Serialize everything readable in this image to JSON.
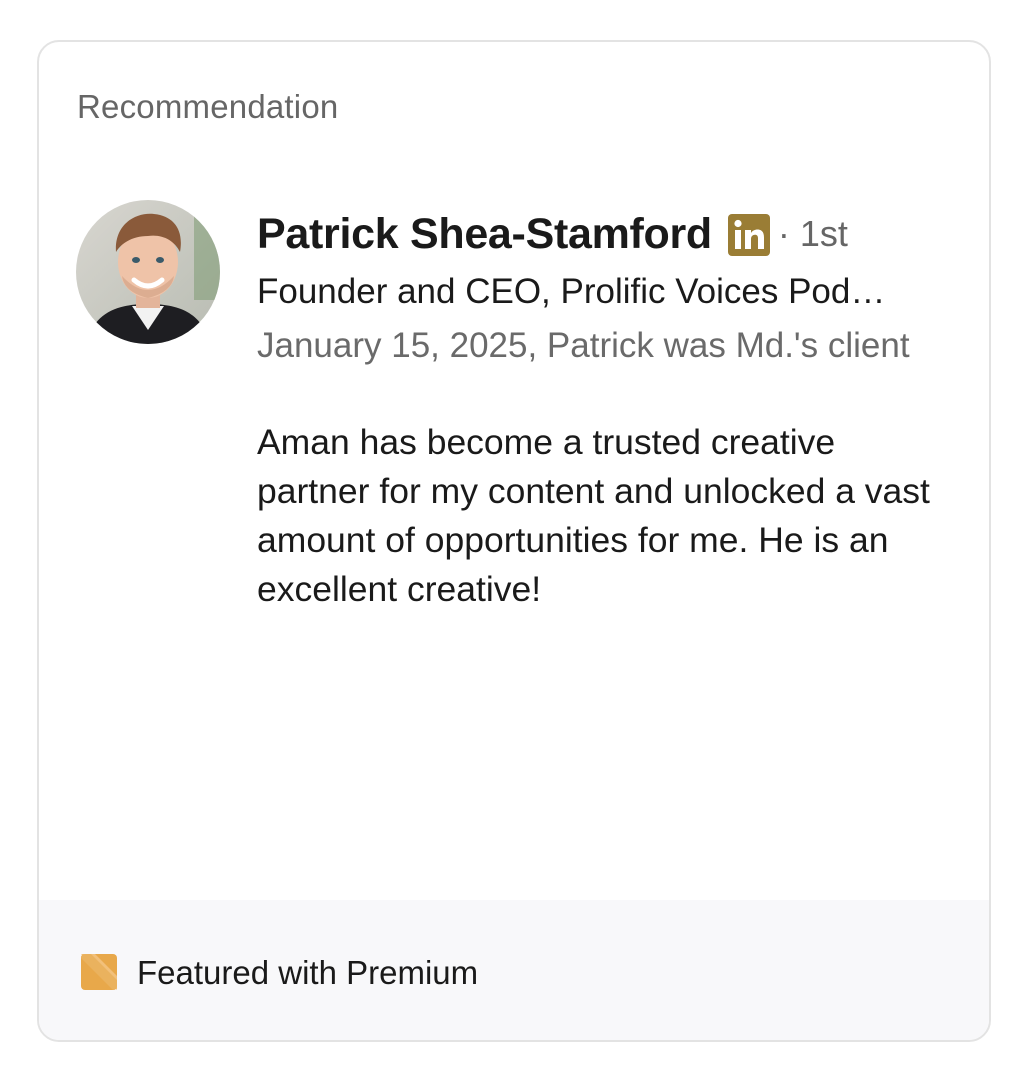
{
  "section": {
    "title": "Recommendation"
  },
  "recommender": {
    "name": "Patrick Shea-Stamford",
    "degree": "· 1st",
    "headline": "Founder and CEO, Prolific Voices Podcasting",
    "relationship": "January 15, 2025, Patrick was Md.'s client",
    "avatar": "profile-photo"
  },
  "recommendation": {
    "text": "Aman has become a trusted creative partner for my content and unlocked a vast amount of opportunities for me. He is an excellent creative!"
  },
  "footer": {
    "label": "Featured with Premium",
    "icon": "premium-badge-icon"
  },
  "colors": {
    "premium_gold": "#9a7d35",
    "premium_badge": "#e8a84a",
    "meta_gray": "#666666",
    "footer_bg": "#f8f8fa"
  }
}
